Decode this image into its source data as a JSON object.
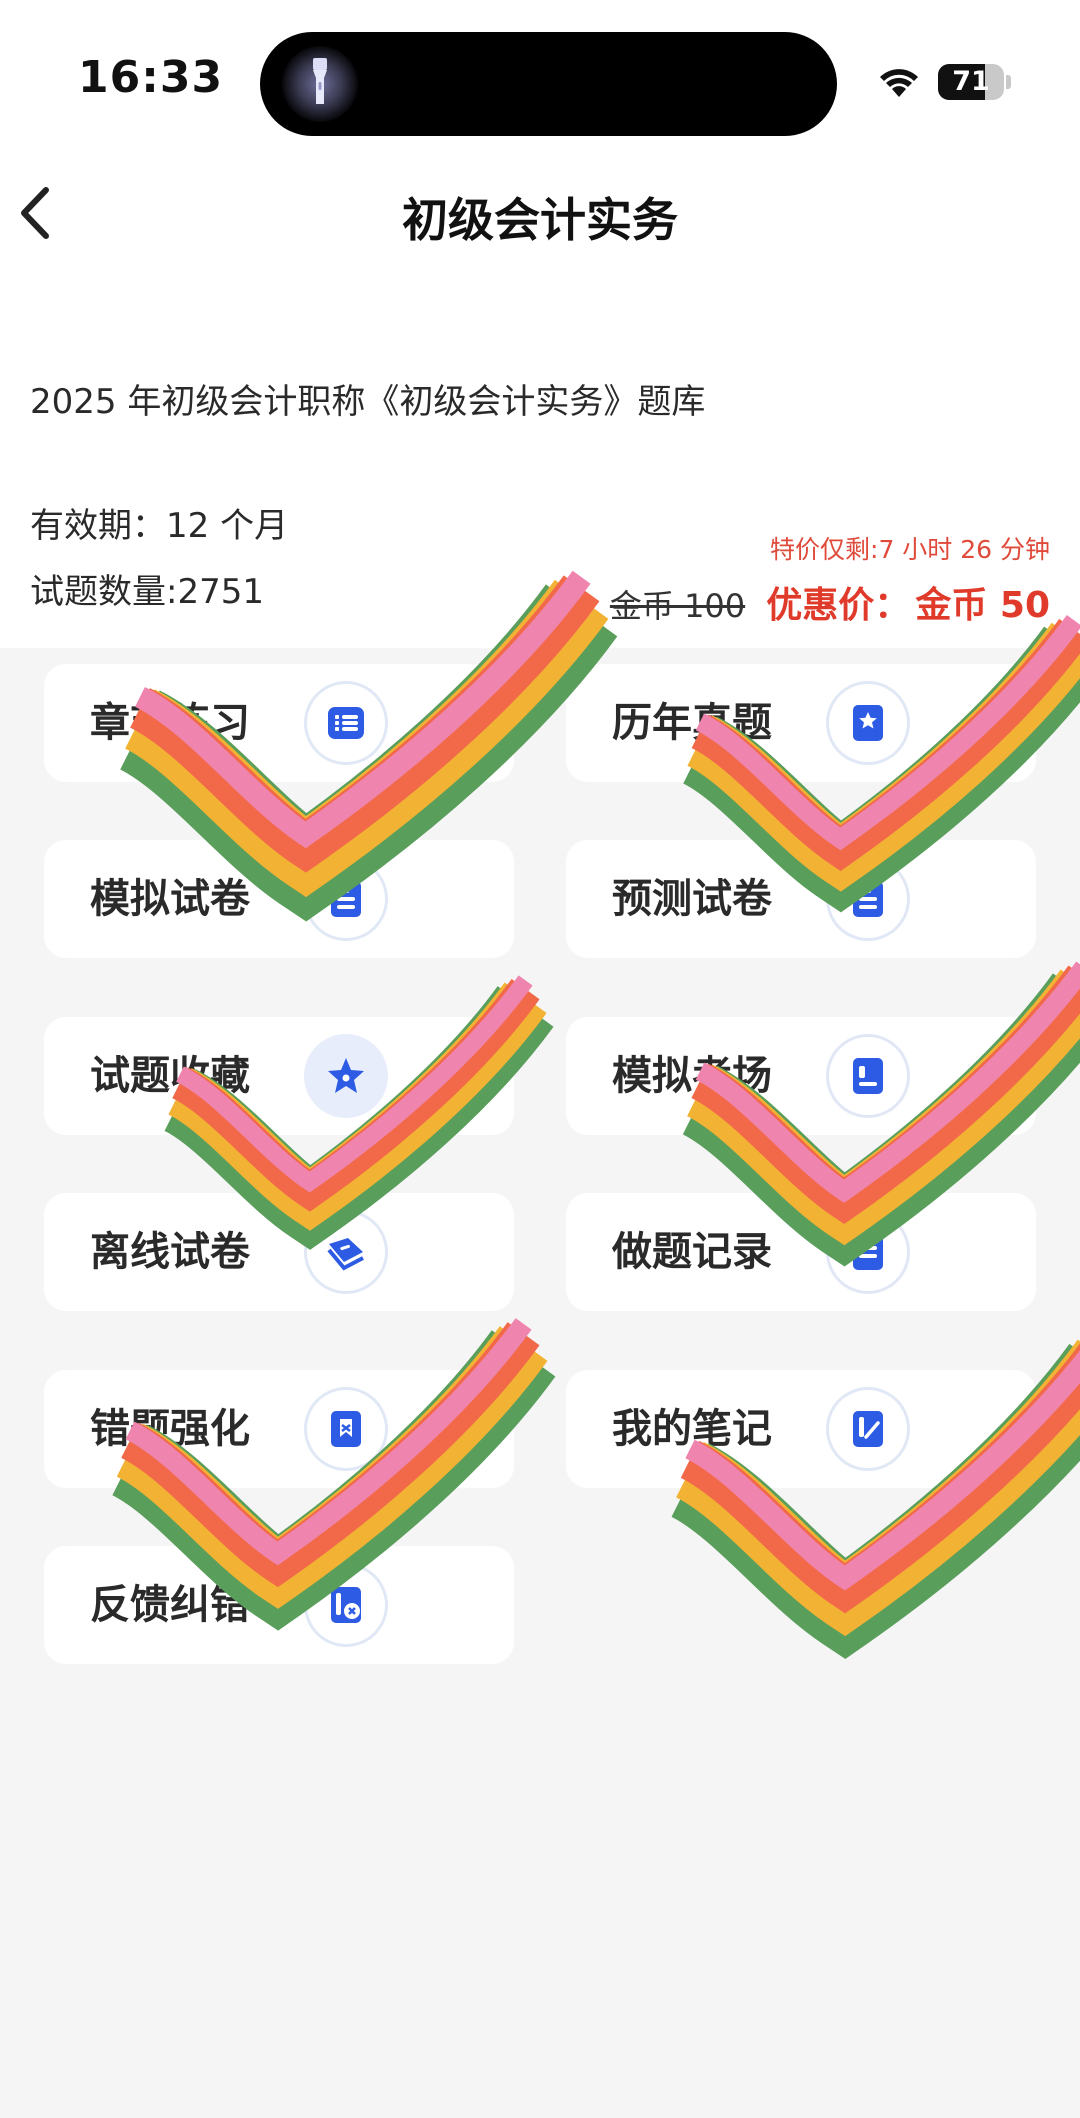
{
  "status_bar": {
    "time": "16:33",
    "battery_level": "71",
    "battery_fraction": 0.71
  },
  "header": {
    "title": "初级会计实务"
  },
  "info": {
    "bank_title": "2025 年初级会计职称《初级会计实务》题库",
    "validity": "有效期：12 个月",
    "question_count": "试题数量:2751",
    "promo_countdown": "特价仅剩:7 小时 26 分钟",
    "original_price": "金币 100",
    "discount_label": "优惠价：",
    "discount_price": "金币 50"
  },
  "menu": [
    {
      "label": "章节练习",
      "icon": "list-icon"
    },
    {
      "label": "历年真题",
      "icon": "bookmark-star-icon"
    },
    {
      "label": "模拟试卷",
      "icon": "paper-icon"
    },
    {
      "label": "预测试卷",
      "icon": "paper-icon"
    },
    {
      "label": "试题收藏",
      "icon": "star-icon"
    },
    {
      "label": "模拟考场",
      "icon": "exam-room-icon"
    },
    {
      "label": "离线试卷",
      "icon": "offline-paper-icon"
    },
    {
      "label": "做题记录",
      "icon": "record-icon"
    },
    {
      "label": "错题强化",
      "icon": "wrong-question-icon"
    },
    {
      "label": "我的笔记",
      "icon": "notes-icon"
    },
    {
      "label": "反馈纠错",
      "icon": "feedback-icon"
    }
  ],
  "colors": {
    "accent": "#2d5be3",
    "price_red": "#e03a2b"
  }
}
